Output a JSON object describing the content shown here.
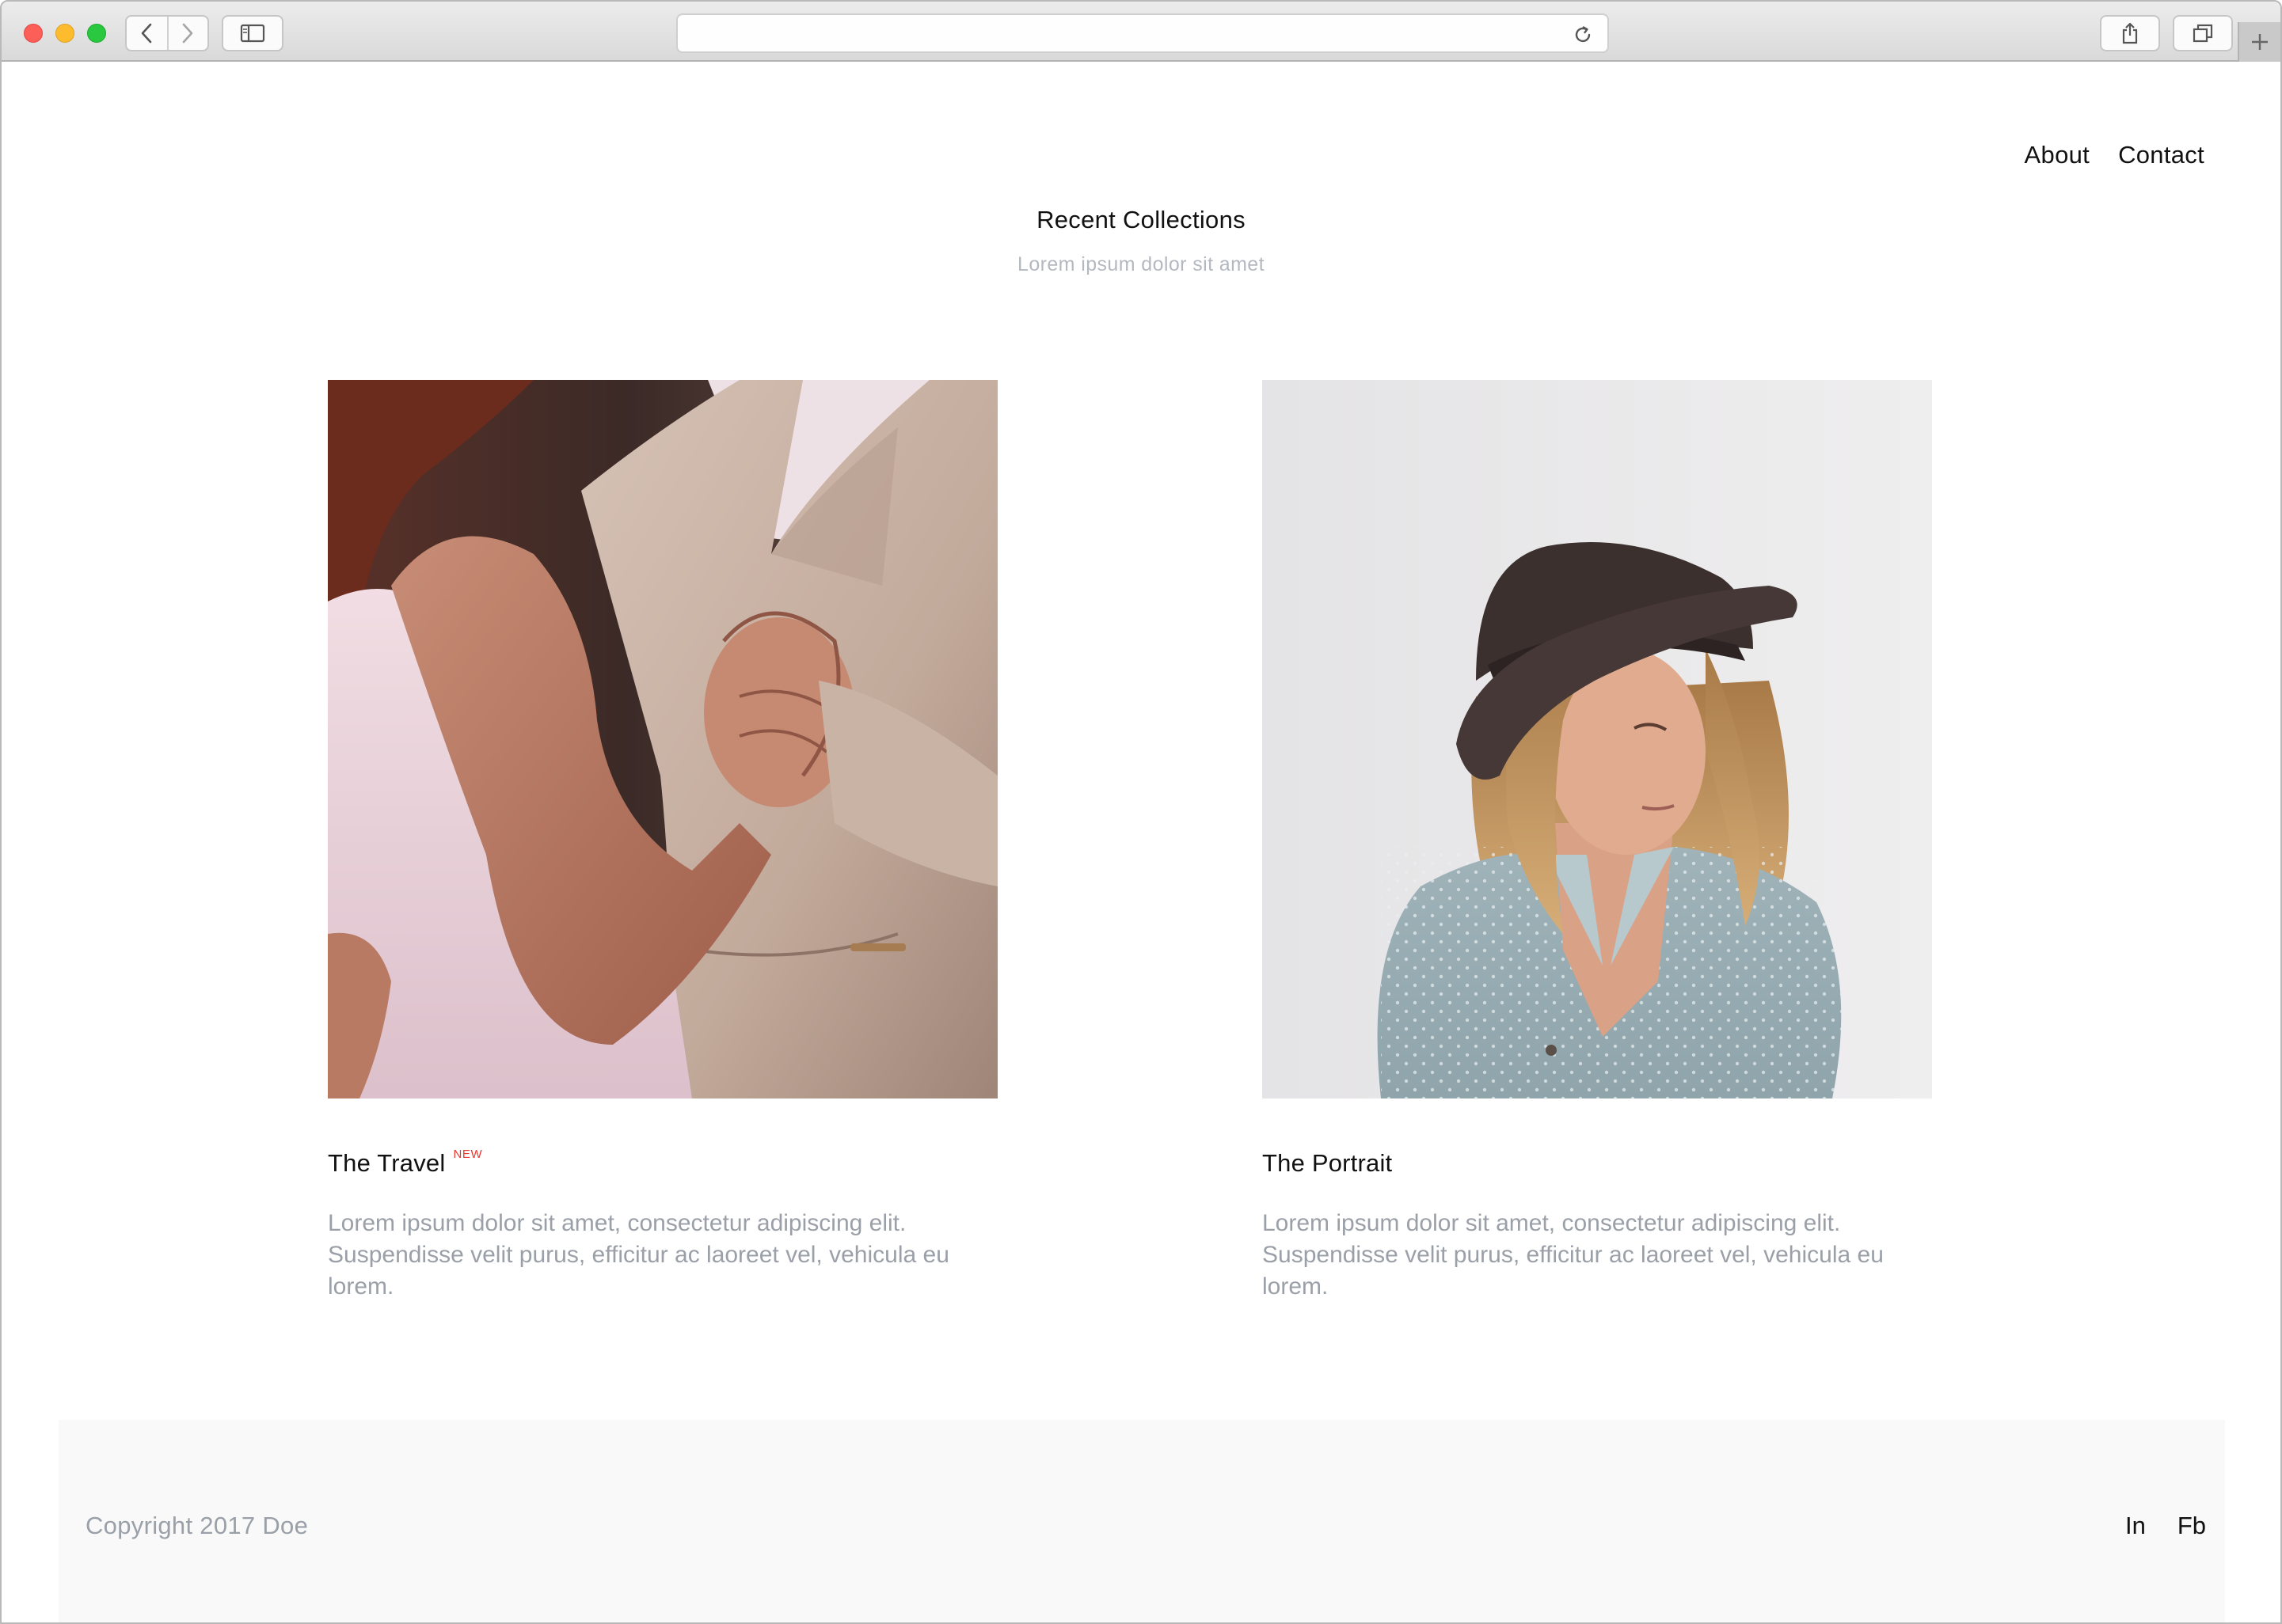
{
  "browser": {
    "url": "",
    "icons": [
      "back-icon",
      "forward-icon",
      "sidebar-icon",
      "reload-icon",
      "share-icon",
      "tabs-icon",
      "plus-icon"
    ]
  },
  "nav": {
    "about": "About",
    "contact": "Contact"
  },
  "section": {
    "title": "Recent Collections",
    "subtitle": "Lorem ipsum dolor sit amet"
  },
  "collections": [
    {
      "title": "The Travel",
      "badge": "NEW",
      "description": "Lorem ipsum dolor sit amet, consectetur adipiscing elit. Suspendisse velit purus, efficitur ac laoreet vel, vehicula eu lorem."
    },
    {
      "title": "The Portrait",
      "badge": "",
      "description": "Lorem ipsum dolor sit amet, consectetur adipiscing elit. Suspendisse velit purus, efficitur ac laoreet vel, vehicula eu lorem."
    }
  ],
  "footer": {
    "copyright": "Copyright 2017 Doe",
    "social_in": "In",
    "social_fb": "Fb"
  },
  "colors": {
    "badge": "#e8382f",
    "muted_text": "#9ba0a8",
    "footer_bg": "#f9f9f9"
  }
}
